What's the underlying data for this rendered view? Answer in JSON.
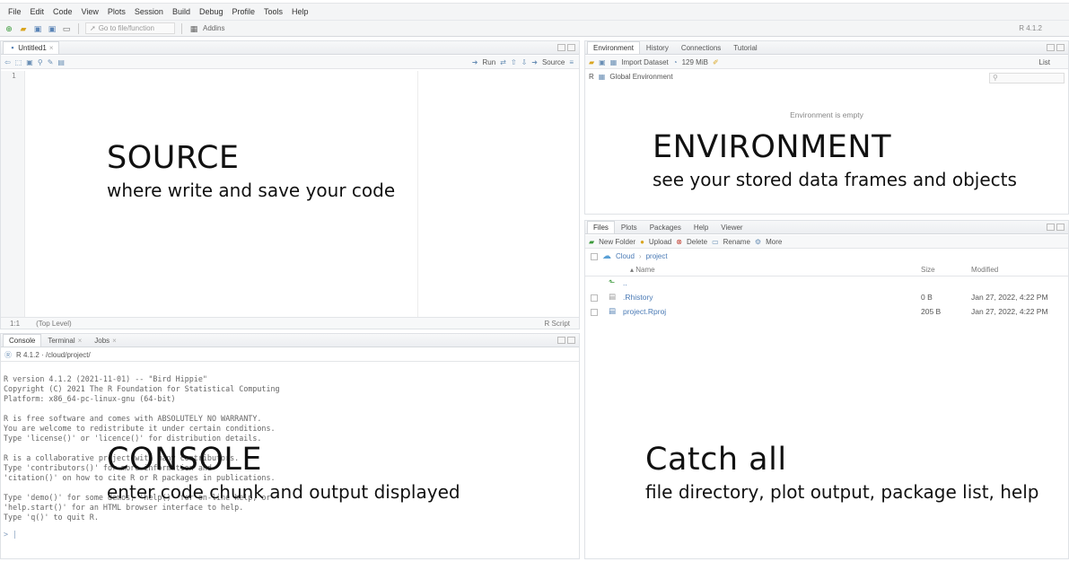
{
  "menubar": {
    "items": [
      "File",
      "Edit",
      "Code",
      "View",
      "Plots",
      "Session",
      "Build",
      "Debug",
      "Profile",
      "Tools",
      "Help"
    ]
  },
  "toolbar": {
    "go_to_placeholder": "Go to file/function",
    "addins_label": "Addins",
    "r_version": "R 4.1.2"
  },
  "source": {
    "tab_label": "Untitled1",
    "run_label": "Run",
    "source_label": "Source",
    "line_number": "1",
    "cursor_pos": "1:1",
    "scope": "(Top Level)",
    "file_type": "R Script"
  },
  "console": {
    "tabs": [
      "Console",
      "Terminal",
      "Jobs"
    ],
    "path": "R 4.1.2 · /cloud/project/",
    "output": "R version 4.1.2 (2021-11-01) -- \"Bird Hippie\"\nCopyright (C) 2021 The R Foundation for Statistical Computing\nPlatform: x86_64-pc-linux-gnu (64-bit)\n\nR is free software and comes with ABSOLUTELY NO WARRANTY.\nYou are welcome to redistribute it under certain conditions.\nType 'license()' or 'licence()' for distribution details.\n\nR is a collaborative project with many contributors.\nType 'contributors()' for more information and\n'citation()' on how to cite R or R packages in publications.\n\nType 'demo()' for some demos, 'help()' for on-line help, or\n'help.start()' for an HTML browser interface to help.\nType 'q()' to quit R.",
    "prompt": ">"
  },
  "environment": {
    "tabs": [
      "Environment",
      "History",
      "Connections",
      "Tutorial"
    ],
    "import_label": "Import Dataset",
    "memory": "129 MiB",
    "list_label": "List",
    "lang": "R",
    "scope": "Global Environment",
    "empty_text": "Environment is empty"
  },
  "files": {
    "tabs": [
      "Files",
      "Plots",
      "Packages",
      "Help",
      "Viewer"
    ],
    "actions": [
      "New Folder",
      "Upload",
      "Delete",
      "Rename",
      "More"
    ],
    "breadcrumb": [
      "Cloud",
      "project"
    ],
    "columns": [
      "Name",
      "Size",
      "Modified"
    ],
    "parent": "..",
    "rows": [
      {
        "name": ".Rhistory",
        "size": "0 B",
        "modified": "Jan 27, 2022, 4:22 PM"
      },
      {
        "name": "project.Rproj",
        "size": "205 B",
        "modified": "Jan 27, 2022, 4:22 PM"
      }
    ]
  },
  "labels": {
    "source_title": "SOURCE",
    "source_sub": "where write and save your code",
    "env_title": "ENVIRONMENT",
    "env_sub": "see your stored data frames and objects",
    "console_title": "CONSOLE",
    "console_sub": "enter code chunk and output displayed",
    "catch_title": "Catch all",
    "catch_sub": "file directory, plot output, package list, help"
  }
}
